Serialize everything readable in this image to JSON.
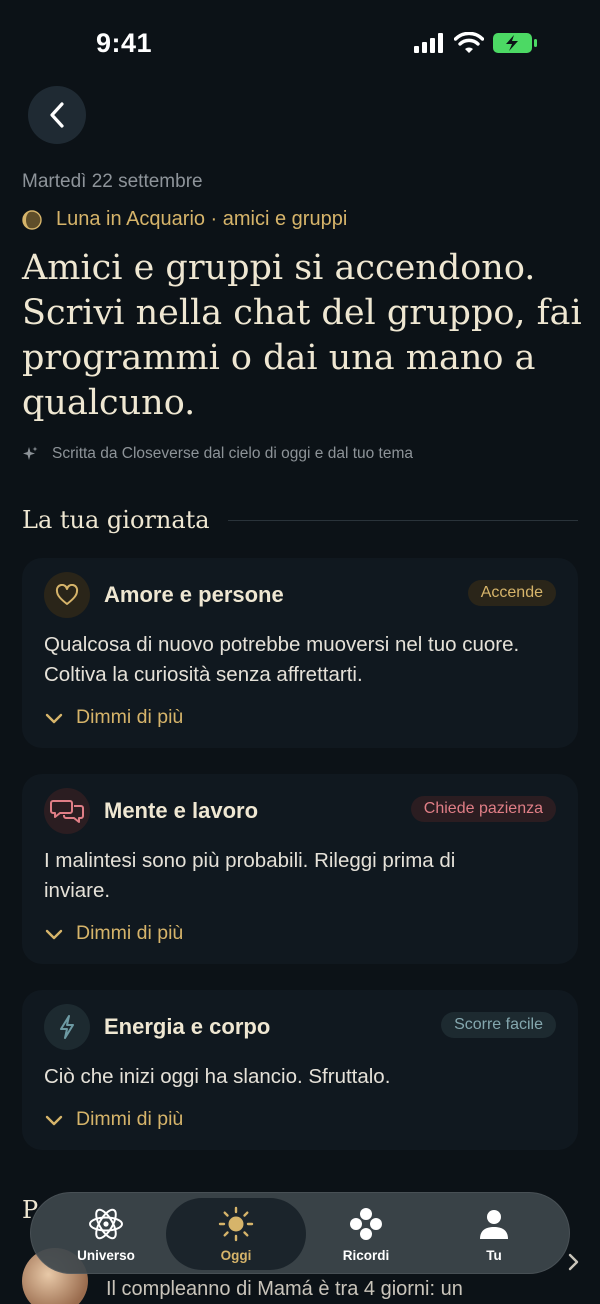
{
  "status": {
    "time": "9:41"
  },
  "date": "Martedì 22 settembre",
  "moon": "Luna in Acquario · amici e gruppi",
  "headline": "Amici e gruppi si accendono. Scrivi nella chat del gruppo, fai programmi o dai una mano a qualcuno.",
  "credit": "Scritta da Closeverse dal cielo di oggi e dal tuo tema",
  "section_title": "La tua giornata",
  "cards": [
    {
      "title": "Amore e persone",
      "badge": "Accende",
      "text": "Qualcosa di nuovo potrebbe muoversi nel tuo cuore. Coltiva la curiosità senza affrettarti.",
      "more": "Dimmi di più"
    },
    {
      "title": "Mente e lavoro",
      "badge": "Chiede pazienza",
      "text": "I malintesi sono più probabili. Rileggi prima di inviare.",
      "more": "Dimmi di più"
    },
    {
      "title": "Energia e corpo",
      "badge": "Scorre facile",
      "text": "Ciò che inizi oggi ha slancio. Sfruttalo.",
      "more": "Dimmi di più"
    }
  ],
  "peek_letter": "P",
  "birthday_text": "Il compleanno di Mamá è tra 4 giorni: un",
  "tabs": [
    {
      "label": "Universo"
    },
    {
      "label": "Oggi"
    },
    {
      "label": "Ricordi"
    },
    {
      "label": "Tu"
    }
  ],
  "colors": {
    "background": "#0c1217",
    "accent": "#d6b46a",
    "card": "#10181f"
  }
}
